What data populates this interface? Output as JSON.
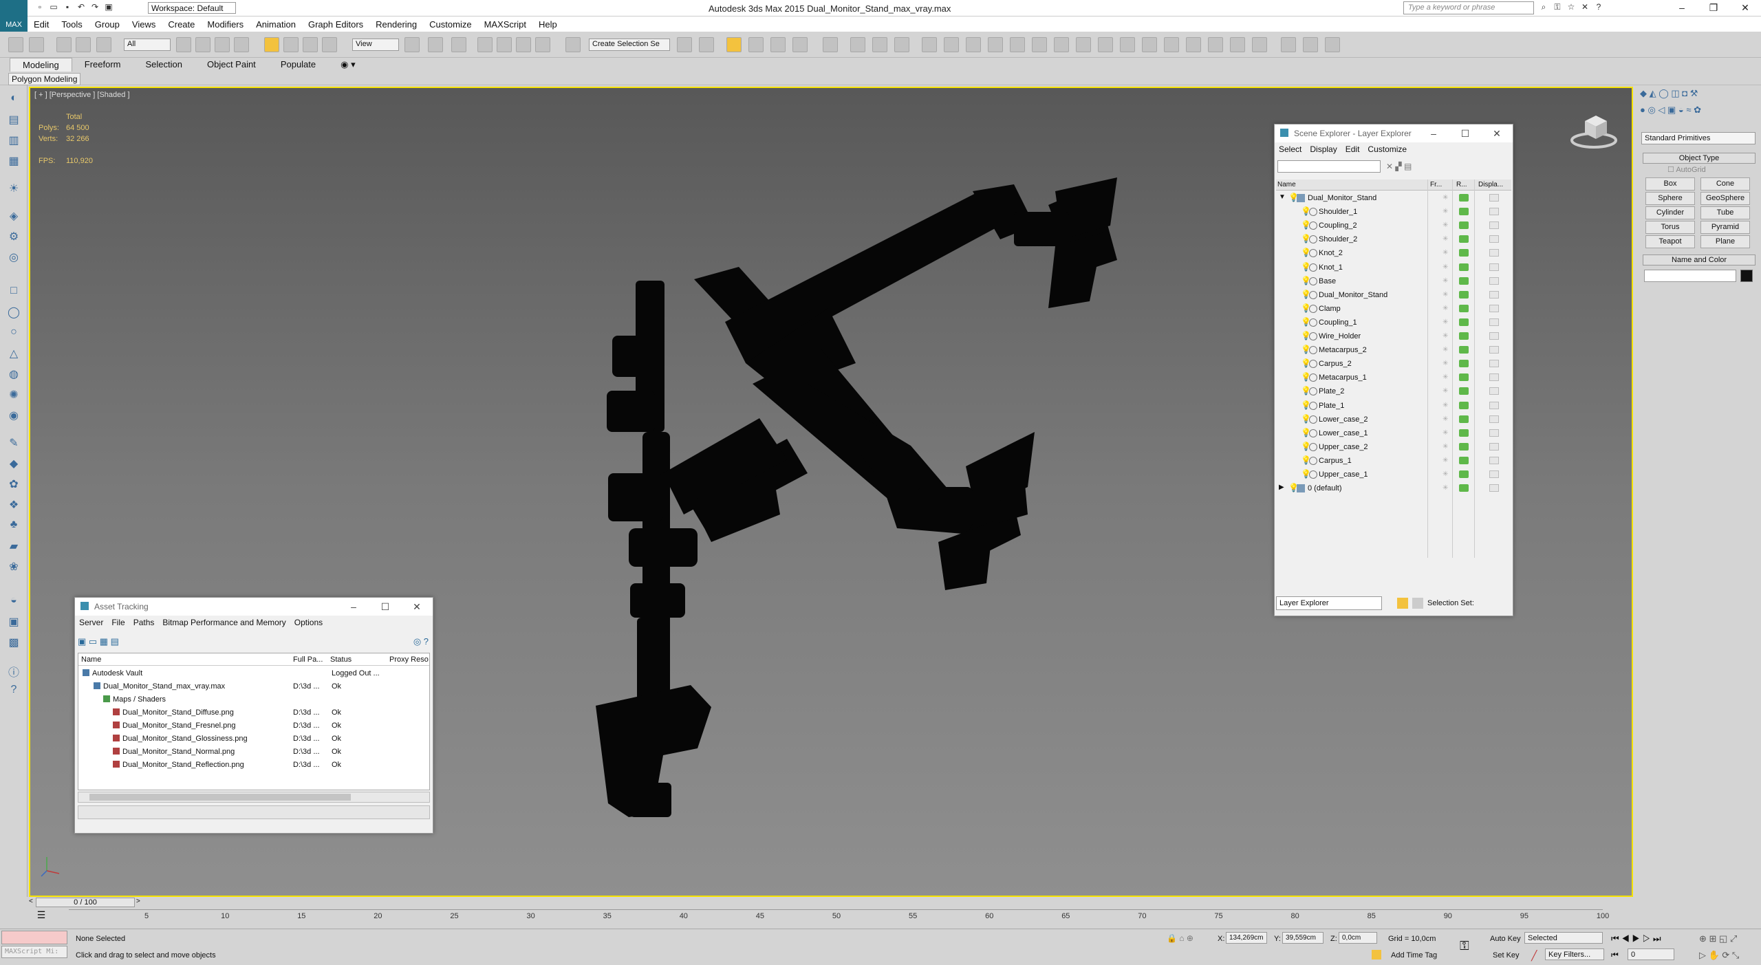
{
  "titlebar": {
    "app_logo": "MAX",
    "workspace": "Workspace: Default",
    "title": "Autodesk 3ds Max  2015    Dual_Monitor_Stand_max_vray.max",
    "search_placeholder": "Type a keyword or phrase"
  },
  "menu": [
    "Edit",
    "Tools",
    "Group",
    "Views",
    "Create",
    "Modifiers",
    "Animation",
    "Graph Editors",
    "Rendering",
    "Customize",
    "MAXScript",
    "Help"
  ],
  "toolbar": {
    "selection_filter": "All",
    "ref_coord": "View",
    "named_selection": "Create Selection Se"
  },
  "ribbon": {
    "tabs": [
      "Modeling",
      "Freeform",
      "Selection",
      "Object Paint",
      "Populate"
    ],
    "active_tab": "Modeling",
    "sub_tab": "Polygon Modeling"
  },
  "viewport": {
    "label": "[ + ] [Perspective ] [Shaded ]",
    "total_label": "Total",
    "polys_label": "Polys:",
    "polys_value": "64 500",
    "verts_label": "Verts:",
    "verts_value": "32 266",
    "fps_label": "FPS:",
    "fps_value": "110,920"
  },
  "scene_explorer": {
    "title": "Scene Explorer - Layer Explorer",
    "menu": [
      "Select",
      "Display",
      "Edit",
      "Customize"
    ],
    "columns": [
      "Name",
      "Fr...",
      "R...",
      "Displa..."
    ],
    "layer": "Dual_Monitor_Stand",
    "objects": [
      "Shoulder_1",
      "Coupling_2",
      "Shoulder_2",
      "Knot_2",
      "Knot_1",
      "Base",
      "Dual_Monitor_Stand",
      "Clamp",
      "Coupling_1",
      "Wire_Holder",
      "Metacarpus_2",
      "Carpus_2",
      "Metacarpus_1",
      "Plate_2",
      "Plate_1",
      "Lower_case_2",
      "Lower_case_1",
      "Upper_case_2",
      "Carpus_1",
      "Upper_case_1"
    ],
    "default_layer": "0 (default)",
    "footer_dropdown": "Layer Explorer",
    "selection_set_label": "Selection Set:"
  },
  "asset_tracking": {
    "title": "Asset Tracking",
    "menu": [
      "Server",
      "File",
      "Paths",
      "Bitmap Performance and Memory",
      "Options"
    ],
    "columns": [
      "Name",
      "Full Pa...",
      "Status",
      "Proxy Reso"
    ],
    "rows": [
      {
        "name": "Autodesk Vault",
        "path": "",
        "status": "Logged Out ..."
      },
      {
        "name": "Dual_Monitor_Stand_max_vray.max",
        "path": "D:\\3d ...",
        "status": "Ok"
      },
      {
        "name": "Maps / Shaders",
        "path": "",
        "status": ""
      },
      {
        "name": "Dual_Monitor_Stand_Diffuse.png",
        "path": "D:\\3d ...",
        "status": "Ok"
      },
      {
        "name": "Dual_Monitor_Stand_Fresnel.png",
        "path": "D:\\3d ...",
        "status": "Ok"
      },
      {
        "name": "Dual_Monitor_Stand_Glossiness.png",
        "path": "D:\\3d ...",
        "status": "Ok"
      },
      {
        "name": "Dual_Monitor_Stand_Normal.png",
        "path": "D:\\3d ...",
        "status": "Ok"
      },
      {
        "name": "Dual_Monitor_Stand_Reflection.png",
        "path": "D:\\3d ...",
        "status": "Ok"
      }
    ]
  },
  "command_panel": {
    "category": "Standard Primitives",
    "object_type_label": "Object Type",
    "autogrid": "AutoGrid",
    "buttons": [
      "Box",
      "Cone",
      "Sphere",
      "GeoSphere",
      "Cylinder",
      "Tube",
      "Torus",
      "Pyramid",
      "Teapot",
      "Plane"
    ],
    "name_color_label": "Name and Color"
  },
  "timeline": {
    "frame": "0 / 100",
    "ticks": [
      "5",
      "10",
      "15",
      "20",
      "25",
      "30",
      "35",
      "40",
      "45",
      "50",
      "55",
      "60",
      "65",
      "70",
      "75",
      "80",
      "85",
      "90",
      "95",
      "100"
    ]
  },
  "status": {
    "maxscript": "MAXScript Mi:",
    "selection": "None Selected",
    "prompt": "Click and drag to select and move objects",
    "x_label": "X:",
    "x_value": "134,269cm",
    "y_label": "Y:",
    "y_value": "39,559cm",
    "z_label": "Z:",
    "z_value": "0,0cm",
    "grid": "Grid = 10,0cm",
    "add_time_tag": "Add Time Tag",
    "auto_key": "Auto Key",
    "set_key": "Set Key",
    "selected_dropdown": "Selected",
    "key_filters": "Key Filters...",
    "frame_field": "0"
  },
  "colors": {
    "viewport_border": "#f5e200",
    "stats_text": "#e8c86a",
    "layer_on": "#5fb84a"
  }
}
